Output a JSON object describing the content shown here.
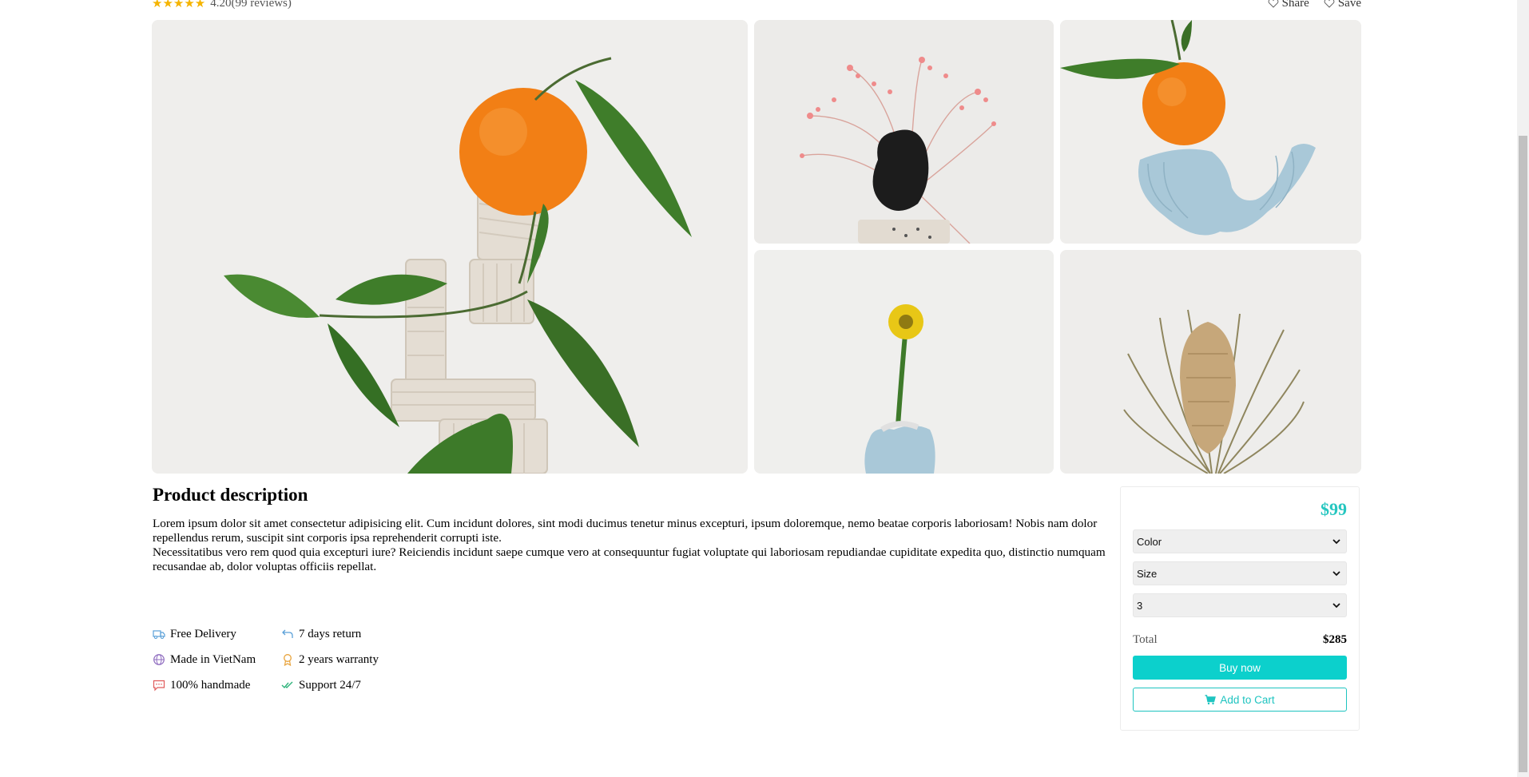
{
  "header": {
    "stars": "★★★★★",
    "rating": "4.20",
    "reviews": "(99 reviews)",
    "share_label": "Share",
    "save_label": "Save"
  },
  "gallery": {
    "icons": [
      "orange-sculpture-image",
      "pink-flowers-image",
      "orange-blue-vase-image",
      "yellow-flower-image",
      "dried-banksia-image"
    ]
  },
  "description": {
    "title": "Product description",
    "paragraph_1": "Lorem ipsum dolor sit amet consectetur adipisicing elit. Cum incidunt dolores, sint modi ducimus tenetur minus excepturi, ipsum doloremque, nemo beatae corporis laboriosam! Nobis nam dolor repellendus rerum, suscipit sint corporis ipsa reprehenderit corrupti iste.",
    "paragraph_2": "Necessitatibus vero rem quod quia excepturi iure? Reiciendis incidunt saepe cumque vero at consequuntur fugiat voluptate qui laboriosam repudiandae cupiditate expedita quo, distinctio numquam recusandae ab, dolor voluptas officiis repellat."
  },
  "features": {
    "items": [
      {
        "label": "Free Delivery",
        "icon": "truck-icon",
        "color": "#5aa0d8"
      },
      {
        "label": "7 days return",
        "icon": "return-arrow-icon",
        "color": "#5aa0d8"
      },
      {
        "label": "Made in VietNam",
        "icon": "globe-icon",
        "color": "#8e6bbf"
      },
      {
        "label": "2 years warranty",
        "icon": "award-icon",
        "color": "#e8a33b"
      },
      {
        "label": "100% handmade",
        "icon": "chat-icon",
        "color": "#e05a5a"
      },
      {
        "label": "Support 24/7",
        "icon": "double-check-icon",
        "color": "#2db37a"
      }
    ]
  },
  "purchase": {
    "price": "$99",
    "color_select": "Color",
    "size_select": "Size",
    "quantity_select": "3",
    "total_label": "Total",
    "total_value": "$285",
    "buy_label": "Buy now",
    "cart_label": "Add to Cart",
    "accent": "#0cd0cc"
  }
}
